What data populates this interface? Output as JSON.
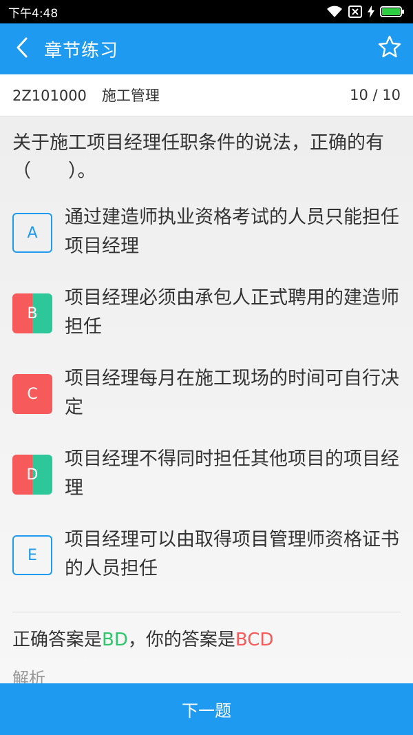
{
  "status_bar": {
    "time": "下午4:48"
  },
  "app_bar": {
    "title": "章节练习"
  },
  "chapter": {
    "code": "2Z101000",
    "name": "施工管理",
    "progress": "10 / 10"
  },
  "question": {
    "text": "关于施工项目经理任职条件的说法，正确的有（　　）。"
  },
  "options": [
    {
      "letter": "A",
      "text": "通过建造师执业资格考试的人员只能担任项目经理",
      "state": "plain"
    },
    {
      "letter": "B",
      "text": "项目经理必须由承包人正式聘用的建造师担任",
      "state": "mixed"
    },
    {
      "letter": "C",
      "text": "项目经理每月在施工现场的时间可自行决定",
      "state": "wrong"
    },
    {
      "letter": "D",
      "text": "项目经理不得同时担任其他项目的项目经理",
      "state": "mixed"
    },
    {
      "letter": "E",
      "text": "项目经理可以由取得项目管理师资格证书的人员担任",
      "state": "plain"
    }
  ],
  "answer": {
    "prefix": "正确答案是",
    "correct": "BD",
    "middle": "，你的答案是",
    "mine": "BCD"
  },
  "analysis_label": "解析",
  "next_button": "下一题",
  "colors": {
    "primary": "#1e9bf0",
    "wrong": "#f75a5a",
    "correct": "#2ec79a",
    "answer_correct_text": "#2ec76b"
  }
}
